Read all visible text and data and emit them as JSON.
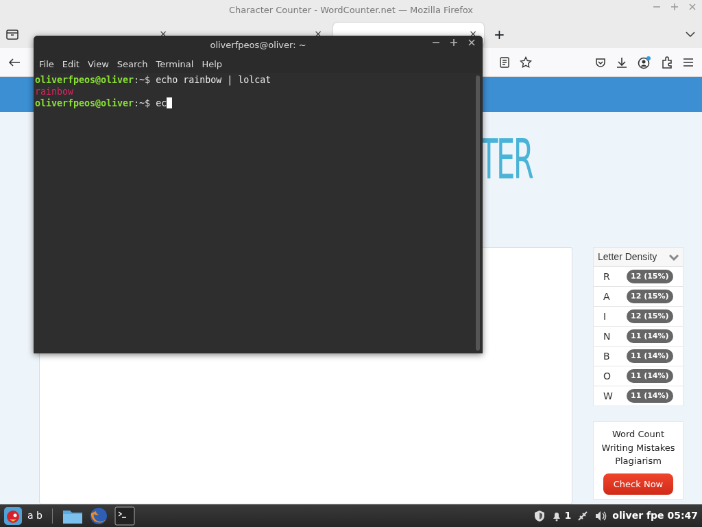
{
  "browser": {
    "title": "Character Counter - WordCounter.net — Mozilla Firefox",
    "tabs": [
      {
        "close": "×",
        "selected": false
      },
      {
        "close": "×",
        "selected": false
      },
      {
        "close": "×",
        "selected": true
      }
    ],
    "new_tab": "+"
  },
  "page": {
    "heading": "TER",
    "letter_density": {
      "title": "Letter Density",
      "rows": [
        {
          "letter": "R",
          "count": "12 (15%)"
        },
        {
          "letter": "A",
          "count": "12 (15%)"
        },
        {
          "letter": "I",
          "count": "12 (15%)"
        },
        {
          "letter": "N",
          "count": "11 (14%)"
        },
        {
          "letter": "B",
          "count": "11 (14%)"
        },
        {
          "letter": "O",
          "count": "11 (14%)"
        },
        {
          "letter": "W",
          "count": "11 (14%)"
        }
      ]
    },
    "ad": {
      "lines": [
        "Word Count",
        "Writing Mistakes",
        "Plagiarism"
      ],
      "button": "Check Now"
    }
  },
  "terminal": {
    "title": "oliverfpeos@oliver: ~",
    "menu": [
      "File",
      "Edit",
      "View",
      "Search",
      "Terminal",
      "Help"
    ],
    "lines": [
      {
        "kind": "prompt",
        "user": "oliverfpeos@oliver",
        "path": ":~$ ",
        "command": "echo rainbow | lolcat",
        "cursor": false
      },
      {
        "kind": "output",
        "text": "rainbow"
      },
      {
        "kind": "prompt",
        "user": "oliverfpeos@oliver",
        "path": ":~$ ",
        "command": "ec",
        "cursor": true
      }
    ]
  },
  "taskbar": {
    "launcher_text": "a b",
    "tray_count": "1",
    "clock": "oliver fpe 05:47"
  }
}
